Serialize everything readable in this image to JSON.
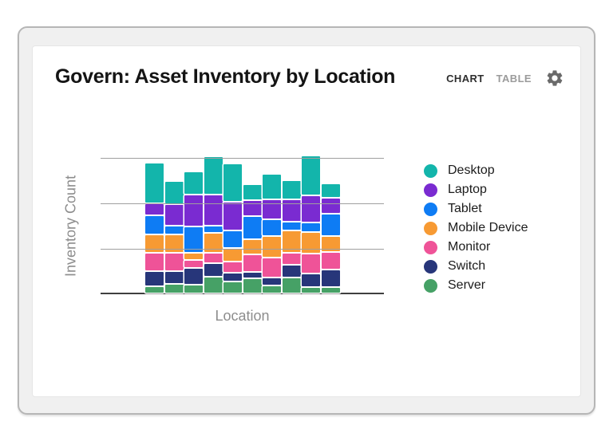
{
  "header": {
    "title": "Govern: Asset Inventory by Location",
    "tabs": [
      {
        "id": "chart",
        "label": "CHART",
        "active": true
      },
      {
        "id": "table",
        "label": "TABLE",
        "active": false
      }
    ],
    "settings_icon": "gear"
  },
  "chart_data": {
    "type": "bar",
    "stacked": true,
    "title": "Govern: Asset Inventory by Location",
    "xlabel": "Location",
    "ylabel": "Inventory Count",
    "x_tick_labels": [],
    "y_tick_labels": [],
    "y_axis_ticks_labeled": false,
    "grid": "horizontal",
    "gridline_count": 3,
    "legend_position": "right",
    "bar_count": 10,
    "ylim": [
      0,
      171
    ],
    "series": [
      {
        "name": "Server",
        "color": "#46A166",
        "values": [
          7,
          10,
          9,
          19,
          13,
          17,
          8,
          18,
          6,
          6
        ]
      },
      {
        "name": "Switch",
        "color": "#27367A",
        "values": [
          17,
          14,
          19,
          15,
          9,
          6,
          8,
          14,
          15,
          20
        ]
      },
      {
        "name": "Monitor",
        "color": "#EF5398",
        "values": [
          21,
          21,
          8,
          11,
          12,
          20,
          23,
          13,
          23,
          20
        ]
      },
      {
        "name": "Mobile Device",
        "color": "#F79A33",
        "values": [
          21,
          21,
          7,
          23,
          15,
          17,
          25,
          26,
          25,
          18
        ]
      },
      {
        "name": "Tablet",
        "color": "#0E7CF4",
        "values": [
          22,
          9,
          31,
          7,
          20,
          27,
          19,
          9,
          10,
          26
        ]
      },
      {
        "name": "Laptop",
        "color": "#7A2BD1",
        "values": [
          13,
          25,
          38,
          37,
          34,
          18,
          23,
          26,
          32,
          18
        ]
      },
      {
        "name": "Desktop",
        "color": "#13B5AB",
        "values": [
          49,
          27,
          27,
          46,
          46,
          18,
          30,
          22,
          48,
          16
        ]
      }
    ],
    "legend_top_to_bottom": [
      "Desktop",
      "Laptop",
      "Tablet",
      "Mobile Device",
      "Monitor",
      "Switch",
      "Server"
    ]
  }
}
